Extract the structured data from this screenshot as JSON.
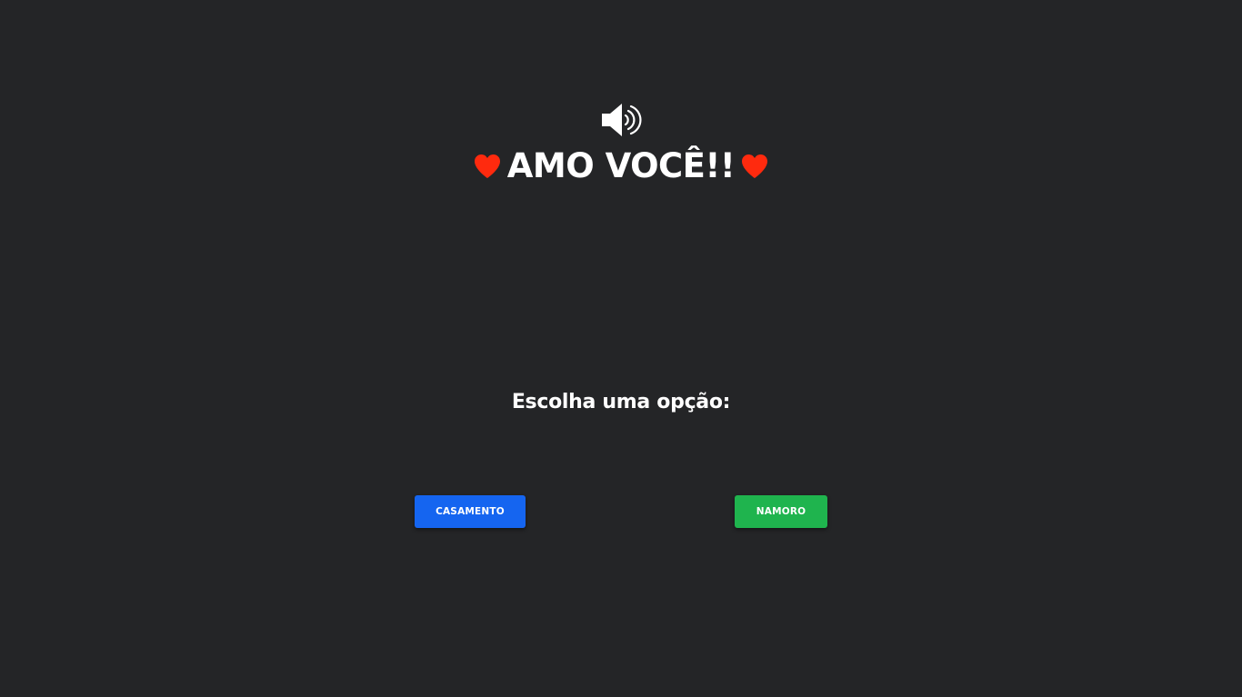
{
  "header": {
    "speaker_icon": "speaker-volume-icon",
    "heart_icon": "heart-icon",
    "heart_color": "#ff2a0e",
    "title": "AMO VOCÊ!!"
  },
  "main": {
    "prompt": "Escolha uma opção:",
    "options": [
      {
        "label": "CASAMENTO",
        "color": "#1565f0"
      },
      {
        "label": "NAMORO",
        "color": "#1fb44e"
      }
    ]
  },
  "background_color": "#242527"
}
